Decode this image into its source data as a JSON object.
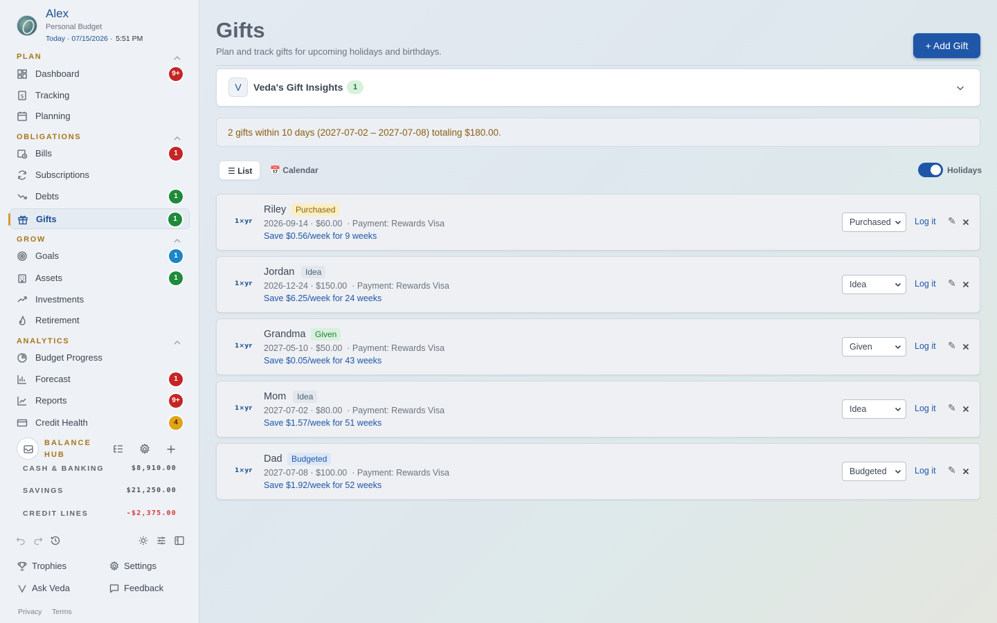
{
  "profile": {
    "name": "Alex",
    "subtitle": "Personal Budget",
    "today": "Today · 07/15/2026 ·",
    "time": "5:51 PM"
  },
  "sidebar": {
    "sections": {
      "plan": "PLAN",
      "obligations": "OBLIGATIONS",
      "grow": "GROW",
      "analytics": "ANALYTICS"
    },
    "items": {
      "dashboard": {
        "label": "Dashboard",
        "badge": "9+"
      },
      "tracking": {
        "label": "Tracking"
      },
      "planning": {
        "label": "Planning"
      },
      "bills": {
        "label": "Bills",
        "badge": "1"
      },
      "subscriptions": {
        "label": "Subscriptions"
      },
      "debts": {
        "label": "Debts",
        "badge": "1"
      },
      "gifts": {
        "label": "Gifts",
        "badge": "1"
      },
      "goals": {
        "label": "Goals",
        "badge": "1"
      },
      "assets": {
        "label": "Assets",
        "badge": "1"
      },
      "investments": {
        "label": "Investments"
      },
      "retirement": {
        "label": "Retirement"
      },
      "budget_progress": {
        "label": "Budget Progress"
      },
      "forecast": {
        "label": "Forecast",
        "badge": "1"
      },
      "reports": {
        "label": "Reports",
        "badge": "9+"
      },
      "credit_health": {
        "label": "Credit Health",
        "badge": "4"
      }
    },
    "balance_hub": {
      "title": "BALANCE HUB",
      "accounts": [
        {
          "label": "CASH & BANKING",
          "amount": "$8,910.00"
        },
        {
          "label": "SAVINGS",
          "amount": "$21,250.00"
        },
        {
          "label": "CREDIT LINES",
          "amount": "-$2,375.00"
        }
      ]
    },
    "footer": {
      "trophies": "Trophies",
      "settings": "Settings",
      "ask_veda": "Ask Veda",
      "feedback": "Feedback",
      "privacy": "Privacy",
      "terms": "Terms"
    }
  },
  "main": {
    "title": "Gifts",
    "subtitle": "Plan and track gifts for upcoming holidays and birthdays.",
    "add_button": "+ Add Gift",
    "insights": {
      "icon_letter": "V",
      "title": "Veda's Gift Insights",
      "count": "1"
    },
    "notice": "2 gifts within 10 days (2027-07-02 – 2027-07-08) totaling $180.00.",
    "tabs": {
      "list": "☰ List",
      "calendar": "📅 Calendar"
    },
    "holidays_toggle": "Holidays",
    "log_label": "Log it",
    "gifts": [
      {
        "name": "Riley",
        "status": "Purchased",
        "freq": "1×yr",
        "date": "2026-09-14",
        "amount": "$60.00",
        "payment": "Payment: Rewards Visa",
        "save": "Save $0.56/week for 9 weeks"
      },
      {
        "name": "Jordan",
        "status": "Idea",
        "freq": "1×yr",
        "date": "2026-12-24",
        "amount": "$150.00",
        "payment": "Payment: Rewards Visa",
        "save": "Save $6.25/week for 24 weeks"
      },
      {
        "name": "Grandma",
        "status": "Given",
        "freq": "1×yr",
        "date": "2027-05-10",
        "amount": "$50.00",
        "payment": "Payment: Rewards Visa",
        "save": "Save $0.05/week for 43 weeks"
      },
      {
        "name": "Mom",
        "status": "Idea",
        "freq": "1×yr",
        "date": "2027-07-02",
        "amount": "$80.00",
        "payment": "Payment: Rewards Visa",
        "save": "Save $1.57/week for 51 weeks"
      },
      {
        "name": "Dad",
        "status": "Budgeted",
        "freq": "1×yr",
        "date": "2027-07-08",
        "amount": "$100.00",
        "payment": "Payment: Rewards Visa",
        "save": "Save $1.92/week for 52 weeks"
      }
    ]
  },
  "colors": {
    "accent": "#1f56a8",
    "section_heading": "#a8761a",
    "badge_red": "#c62525",
    "badge_green": "#1f8a3b",
    "badge_blue": "#1a86c8",
    "badge_amber": "#e1a317"
  }
}
